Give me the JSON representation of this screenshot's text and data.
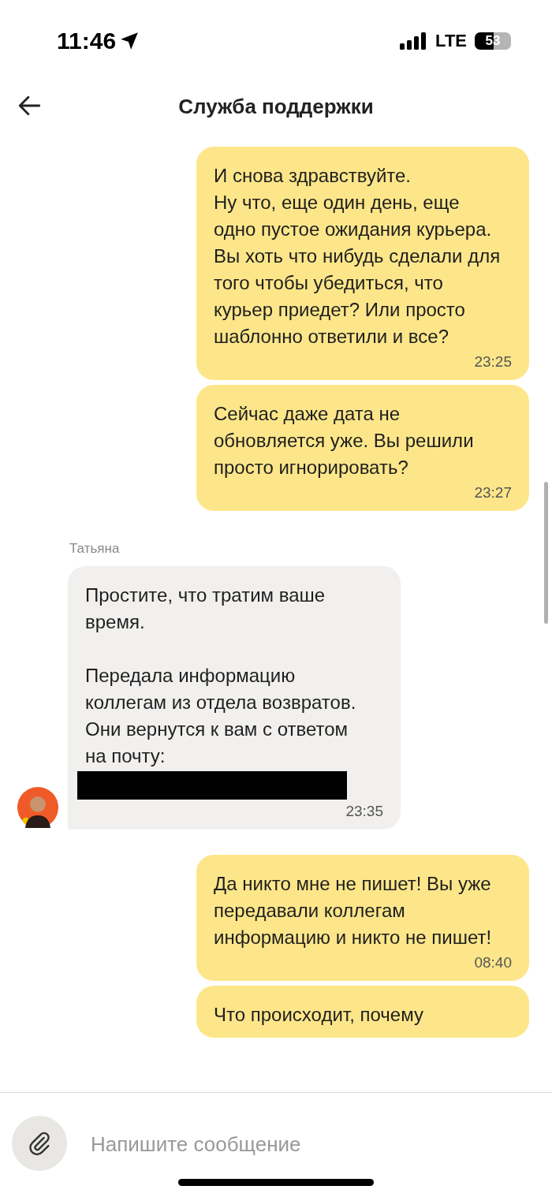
{
  "status_bar": {
    "time": "11:46",
    "network": "LTE",
    "battery": "53"
  },
  "header": {
    "title": "Служба поддержки"
  },
  "messages": [
    {
      "kind": "outgoing",
      "text": "И снова здравствуйте.\nНу что, еще один день, еще одно пустое ожидания курьера.\nВы хоть что нибудь сделали для того чтобы убедиться, что курьер приедет? Или просто шаблонно ответили и все?",
      "time": "23:25"
    },
    {
      "kind": "outgoing",
      "text": "Сейчас даже дата не обновляется уже. Вы решили просто игнорировать?",
      "time": "23:27"
    },
    {
      "kind": "incoming",
      "sender": "Татьяна",
      "text": "Простите, что тратим ваше время.\n\nПередала информацию коллегам из отдела возвратов. Они вернутся к вам с ответом на почту:",
      "redacted": true,
      "time": "23:35"
    },
    {
      "kind": "outgoing",
      "text": "Да никто мне не пишет! Вы уже передавали коллегам информацию и никто не пишет!",
      "time": "08:40"
    },
    {
      "kind": "outgoing",
      "text": "Что происходит, почему"
    }
  ],
  "composer": {
    "placeholder": "Напишите сообщение"
  }
}
